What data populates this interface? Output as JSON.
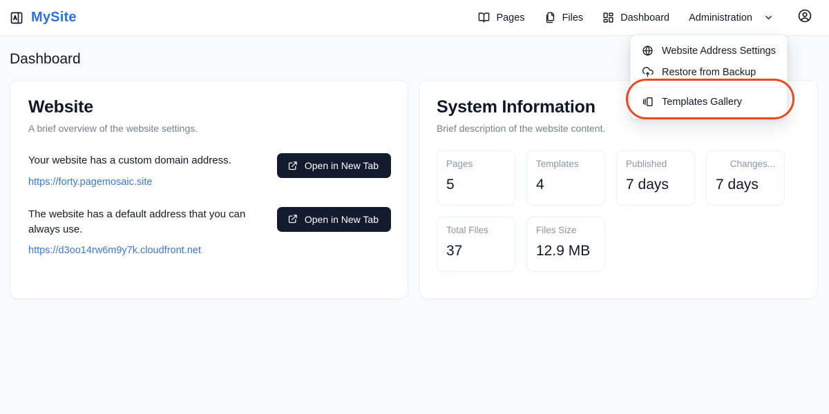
{
  "brand": {
    "name": "MySite",
    "icon": "panel-layout-icon"
  },
  "nav": {
    "items": [
      {
        "label": "Pages",
        "icon": "book-open-icon"
      },
      {
        "label": "Files",
        "icon": "files-copy-icon"
      },
      {
        "label": "Dashboard",
        "icon": "grid-dashboard-icon"
      },
      {
        "label": "Administration",
        "icon": "chevron-down-icon"
      }
    ],
    "avatar_icon": "user-circle-icon"
  },
  "dropdown": {
    "open": true,
    "items": [
      {
        "label": "Website Address Settings",
        "icon": "globe-icon"
      },
      {
        "label": "Restore from Backup",
        "icon": "cloud-upload-icon"
      },
      {
        "label": "Templates Gallery",
        "icon": "templates-panel-icon",
        "highlighted": true
      }
    ],
    "highlight_color": "#e8491f"
  },
  "page": {
    "title": "Dashboard"
  },
  "website_card": {
    "title": "Website",
    "subtitle": "A brief overview of the website settings.",
    "rows": [
      {
        "description": "Your website has a custom domain address.",
        "link": "https://forty.pagemosaic.site",
        "button": "Open in New Tab",
        "button_icon": "external-link-icon"
      },
      {
        "description": "The website has a default address that you can always use.",
        "link": "https://d3oo14rw6m9y7k.cloudfront.net",
        "button": "Open in New Tab",
        "button_icon": "external-link-icon"
      }
    ]
  },
  "system_card": {
    "title": "System Information",
    "subtitle": "Brief description of the website content.",
    "stats": [
      {
        "label": "Pages",
        "value": "5",
        "align": "left"
      },
      {
        "label": "Templates",
        "value": "4",
        "align": "left"
      },
      {
        "label": "Published",
        "value": "7 days",
        "align": "left"
      },
      {
        "label": "Changes...",
        "value": "7 days",
        "align": "right"
      },
      {
        "label": "Total Files",
        "value": "37",
        "align": "left"
      },
      {
        "label": "Files Size",
        "value": "12.9 MB",
        "align": "left"
      }
    ]
  },
  "colors": {
    "brand": "#2f6fe4",
    "link": "#3b77e0",
    "button_bg": "#151b2e",
    "page_bg": "#f8fafc",
    "highlight": "#e8491f"
  }
}
